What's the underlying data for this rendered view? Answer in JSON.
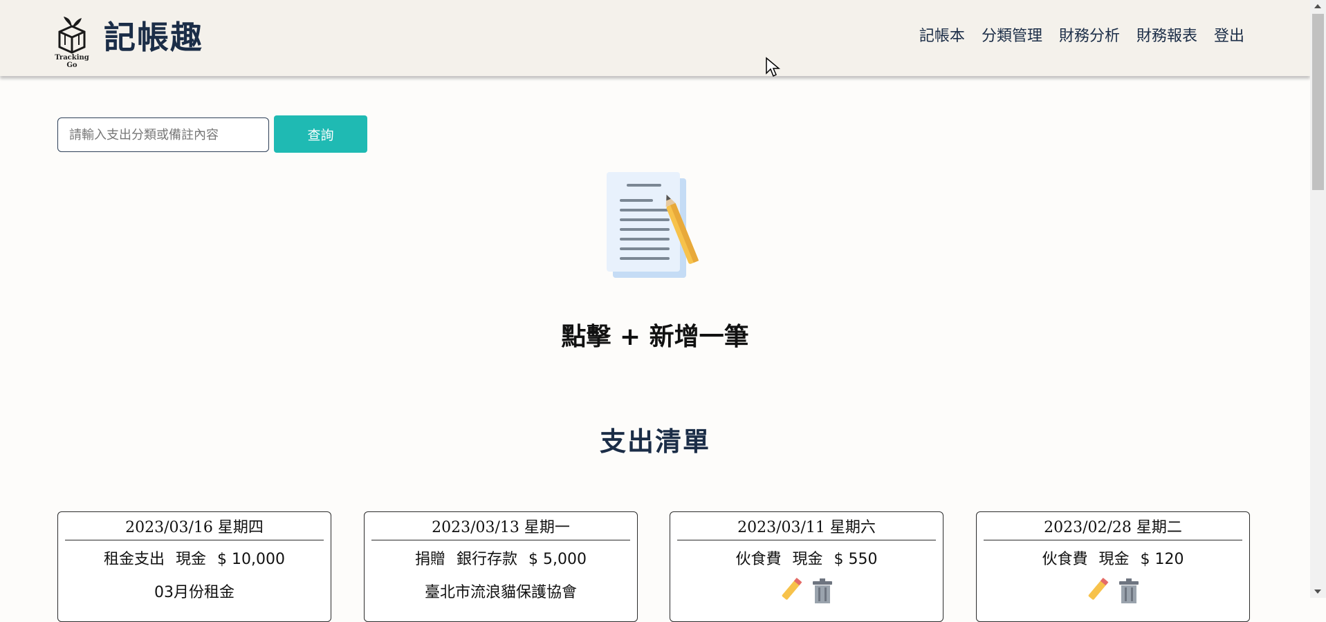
{
  "header": {
    "logo_text": "Tracking Go",
    "brand": "記帳趣",
    "nav": [
      "記帳本",
      "分類管理",
      "財務分析",
      "財務報表",
      "登出"
    ]
  },
  "search": {
    "placeholder": "請輸入支出分類或備註內容",
    "button_label": "查詢"
  },
  "add_hint": "點擊 + 新增一筆",
  "section_title": "支出清單",
  "expenses": [
    {
      "date": "2023/03/16 星期四",
      "category": "租金支出",
      "account": "現金",
      "amount": "$ 10,000",
      "note": "03月份租金"
    },
    {
      "date": "2023/03/13 星期一",
      "category": "捐贈",
      "account": "銀行存款",
      "amount": "$ 5,000",
      "note": "臺北市流浪貓保護協會"
    },
    {
      "date": "2023/03/11 星期六",
      "category": "伙食費",
      "account": "現金",
      "amount": "$ 550",
      "note": ""
    },
    {
      "date": "2023/02/28 星期二",
      "category": "伙食費",
      "account": "現金",
      "amount": "$ 120",
      "note": ""
    }
  ],
  "colors": {
    "accent": "#1fbab3",
    "brand": "#1b2d47",
    "header_bg": "#f4f1eb"
  }
}
